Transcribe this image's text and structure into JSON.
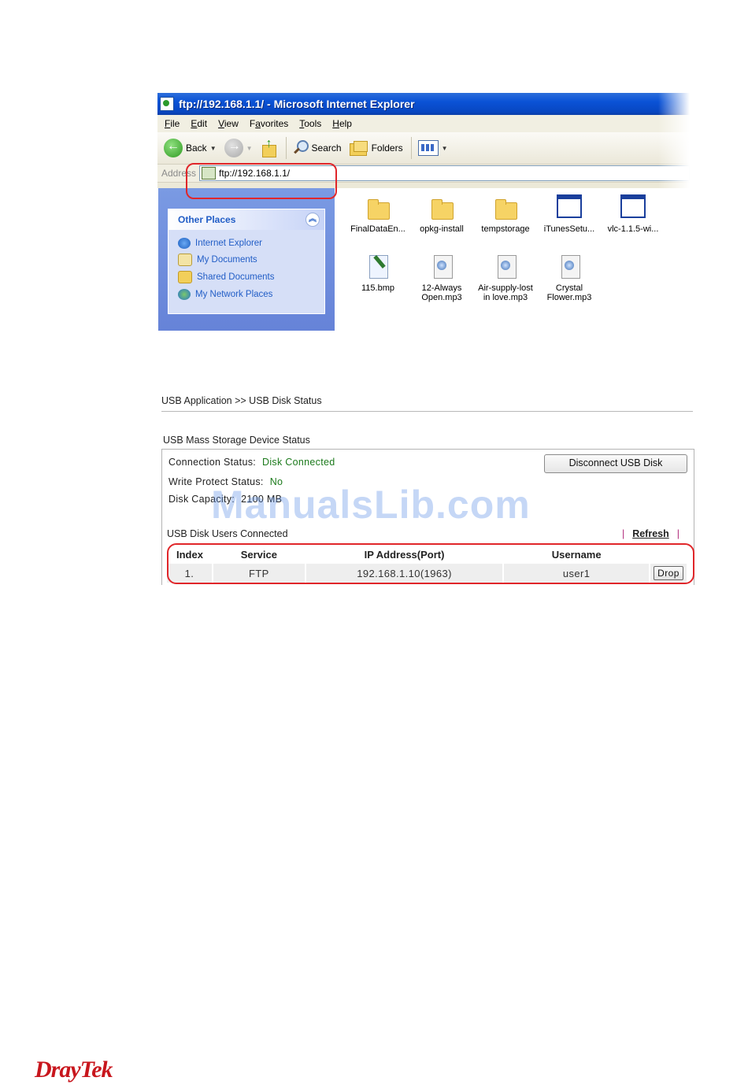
{
  "ie_window": {
    "title": "ftp://192.168.1.1/ - Microsoft Internet Explorer",
    "menu": [
      "File",
      "Edit",
      "View",
      "Favorites",
      "Tools",
      "Help"
    ],
    "menu_underline": [
      "F",
      "E",
      "V",
      "a",
      "T",
      "H"
    ],
    "toolbar": {
      "back_label": "Back",
      "search_label": "Search",
      "folders_label": "Folders"
    },
    "address_label": "Address",
    "address_value": "ftp://192.168.1.1/",
    "task_pane": {
      "title": "Other Places",
      "items": [
        "Internet Explorer",
        "My Documents",
        "Shared Documents",
        "My Network Places"
      ]
    },
    "files": [
      {
        "name": "FinalDataEn...",
        "icon": "folder-icon"
      },
      {
        "name": "opkg-install",
        "icon": "folder-icon"
      },
      {
        "name": "tempstorage",
        "icon": "folder-icon"
      },
      {
        "name": "iTunesSetu...",
        "icon": "exe-icon"
      },
      {
        "name": "vlc-1.1.5-wi...",
        "icon": "exe-icon"
      },
      {
        "name": "115.bmp",
        "icon": "bmp-icon"
      },
      {
        "name": "12-Always Open.mp3",
        "icon": "mp3-icon"
      },
      {
        "name": "Air-supply-lost in love.mp3",
        "icon": "mp3-icon"
      },
      {
        "name": "Crystal Flower.mp3",
        "icon": "mp3-icon"
      }
    ]
  },
  "router": {
    "breadcrumb": "USB Application >> USB Disk Status",
    "section_title": "USB Mass Storage Device Status",
    "connection_status_label": "Connection Status:",
    "connection_status_value": "Disk Connected",
    "write_protect_label": "Write Protect Status:",
    "write_protect_value": "No",
    "disk_capacity_label": "Disk Capacity:",
    "disk_capacity_value": "2100 MB",
    "disconnect_button": "Disconnect USB Disk",
    "users_title": "USB Disk Users Connected",
    "refresh_label": "Refresh",
    "table": {
      "headers": [
        "Index",
        "Service",
        "IP Address(Port)",
        "Username"
      ],
      "rows": [
        {
          "index": "1.",
          "service": "FTP",
          "ip": "192.168.1.10(1963)",
          "username": "user1",
          "action": "Drop"
        }
      ]
    }
  },
  "watermark": "ManualsLib.com",
  "logo": "DrayTek",
  "colors": {
    "accent_red": "#e0262a",
    "status_green": "#1c7a1c",
    "xp_blue": "#0a52d6",
    "logo_red": "#c8161d"
  }
}
